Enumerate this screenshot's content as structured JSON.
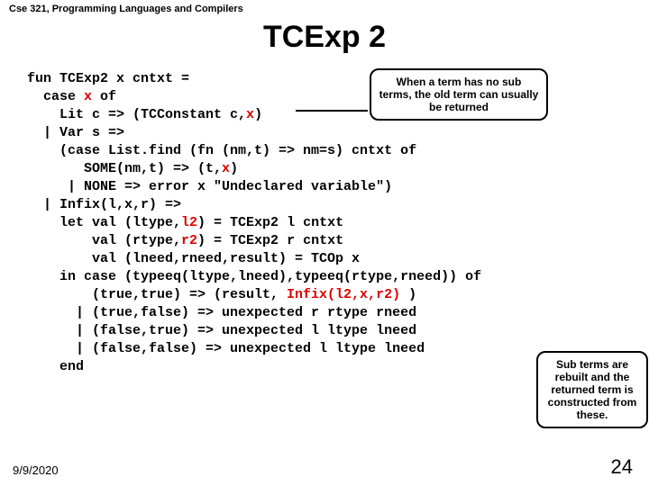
{
  "course": "Cse 321, Programming Languages and Compilers",
  "title": "TCExp 2",
  "code": {
    "l01a": "fun TCExp2 x cntxt =",
    "l02a": "  case ",
    "l02b": "x",
    "l02c": " of",
    "l03a": "    Lit c => (TCConstant c,",
    "l03b": "x",
    "l03c": ")",
    "l04a": "  | Var s =>",
    "l05a": "    (case List.find (fn (nm,t) => nm=s) cntxt of",
    "l06a": "       SOME(nm,t) => (t,",
    "l06b": "x",
    "l06c": ")",
    "l07a": "     | NONE => error x \"Undeclared variable\")",
    "l08a": "  | Infix(l,x,r) =>",
    "l09a": "    let val (ltype,",
    "l09b": "l2",
    "l09c": ") = TCExp2 l cntxt",
    "l10a": "        val (rtype,",
    "l10b": "r2",
    "l10c": ") = TCExp2 r cntxt",
    "l11a": "        val (lneed,rneed,result) = TCOp x",
    "l12a": "    in case (typeeq(ltype,lneed),typeeq(rtype,rneed)) of",
    "l13a": "        (true,true) => (result, ",
    "l13b": "Infix(l2,x,r2)",
    "l13c": " )",
    "l14a": "      | (true,false) => unexpected r rtype rneed",
    "l15a": "      | (false,true) => unexpected l ltype lneed",
    "l16a": "      | (false,false) => unexpected l ltype lneed",
    "l17a": "    end"
  },
  "callout1": "When a term has no sub terms, the old term can usually be returned",
  "callout2": "Sub terms are rebuilt and the returned term is constructed from these.",
  "date": "9/9/2020",
  "page": "24"
}
